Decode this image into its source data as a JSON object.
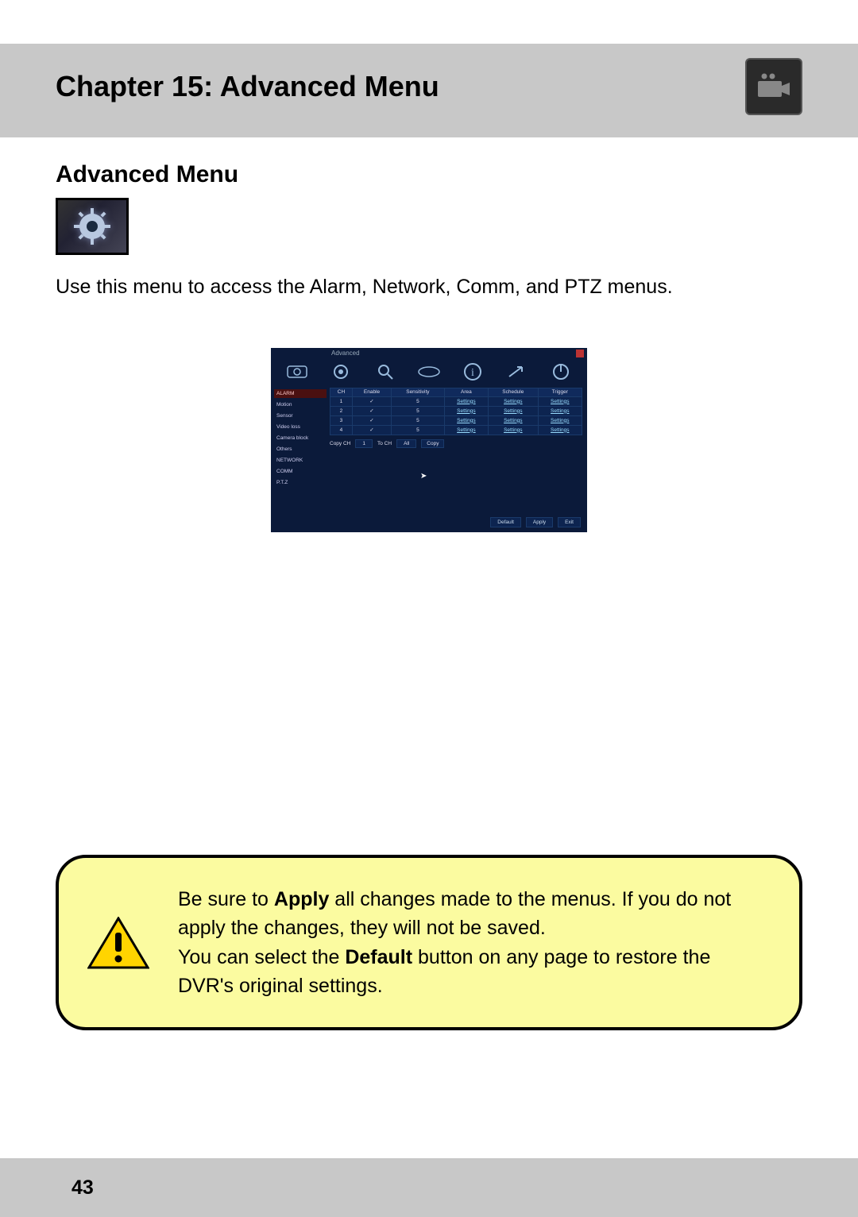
{
  "chapter": {
    "title": "Chapter 15: Advanced Menu"
  },
  "section": {
    "heading": "Advanced Menu"
  },
  "intro": "Use this menu to access the Alarm, Network, Comm, and PTZ menus.",
  "dvr": {
    "window_title": "Advanced",
    "sidebar": [
      {
        "label": "ALARM",
        "selected": true
      },
      {
        "label": "Motion",
        "selected": false
      },
      {
        "label": "Sensor",
        "selected": false
      },
      {
        "label": "Video loss",
        "selected": false
      },
      {
        "label": "Camera block",
        "selected": false
      },
      {
        "label": "Others",
        "selected": false
      },
      {
        "label": "NETWORK",
        "selected": false
      },
      {
        "label": "COMM",
        "selected": false
      },
      {
        "label": "P.T.Z",
        "selected": false
      }
    ],
    "table": {
      "headers": [
        "CH",
        "Enable",
        "Sensitivity",
        "Area",
        "Schedule",
        "Trigger"
      ],
      "rows": [
        {
          "ch": "1",
          "enable": true,
          "sensitivity": "5",
          "area": "Settings",
          "schedule": "Settings",
          "trigger": "Settings"
        },
        {
          "ch": "2",
          "enable": true,
          "sensitivity": "5",
          "area": "Settings",
          "schedule": "Settings",
          "trigger": "Settings"
        },
        {
          "ch": "3",
          "enable": true,
          "sensitivity": "5",
          "area": "Settings",
          "schedule": "Settings",
          "trigger": "Settings"
        },
        {
          "ch": "4",
          "enable": true,
          "sensitivity": "5",
          "area": "Settings",
          "schedule": "Settings",
          "trigger": "Settings"
        }
      ]
    },
    "copy_row": {
      "label": "Copy CH",
      "from": "1",
      "to_label": "To CH",
      "to": "All",
      "button": "Copy"
    },
    "footer": {
      "default": "Default",
      "apply": "Apply",
      "exit": "Exit"
    }
  },
  "callout": {
    "line1a": "Be sure to ",
    "line1b": "Apply",
    "line1c": " all changes made to the menus. If you do not apply the changes, they will not be saved.",
    "line2a": "You can select the ",
    "line2b": "Default",
    "line2c": " button on any page to restore the DVR's original settings."
  },
  "page_number": "43"
}
